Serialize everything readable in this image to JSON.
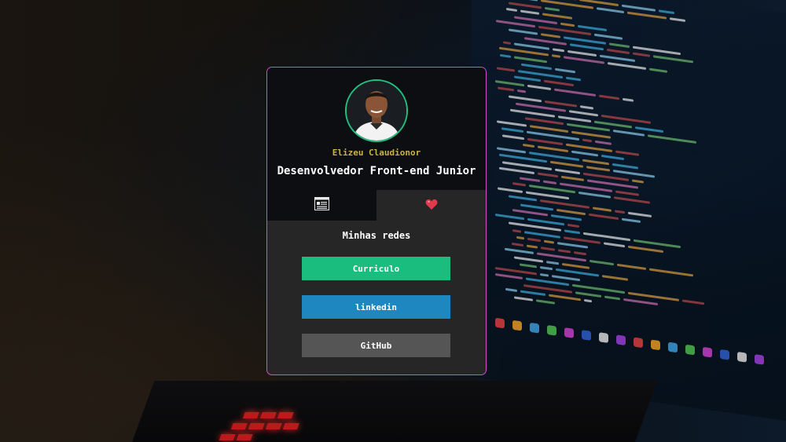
{
  "profile": {
    "name": "Elizeu Claudionor",
    "role": "Desenvolvedor Front-end Junior"
  },
  "tabs": [
    {
      "icon": "document-icon"
    },
    {
      "icon": "heart-icon"
    }
  ],
  "section": {
    "title": "Minhas redes"
  },
  "links": [
    {
      "label": "Curriculo",
      "color": "#1bbd7e"
    },
    {
      "label": "linkedin",
      "color": "#1e87c0"
    },
    {
      "label": "GitHub",
      "color": "#555555"
    }
  ],
  "colors": {
    "card_border": "#d24fd0",
    "avatar_border": "#22c07e",
    "name_color": "#c9b24a",
    "heart": "#e23a4c"
  }
}
